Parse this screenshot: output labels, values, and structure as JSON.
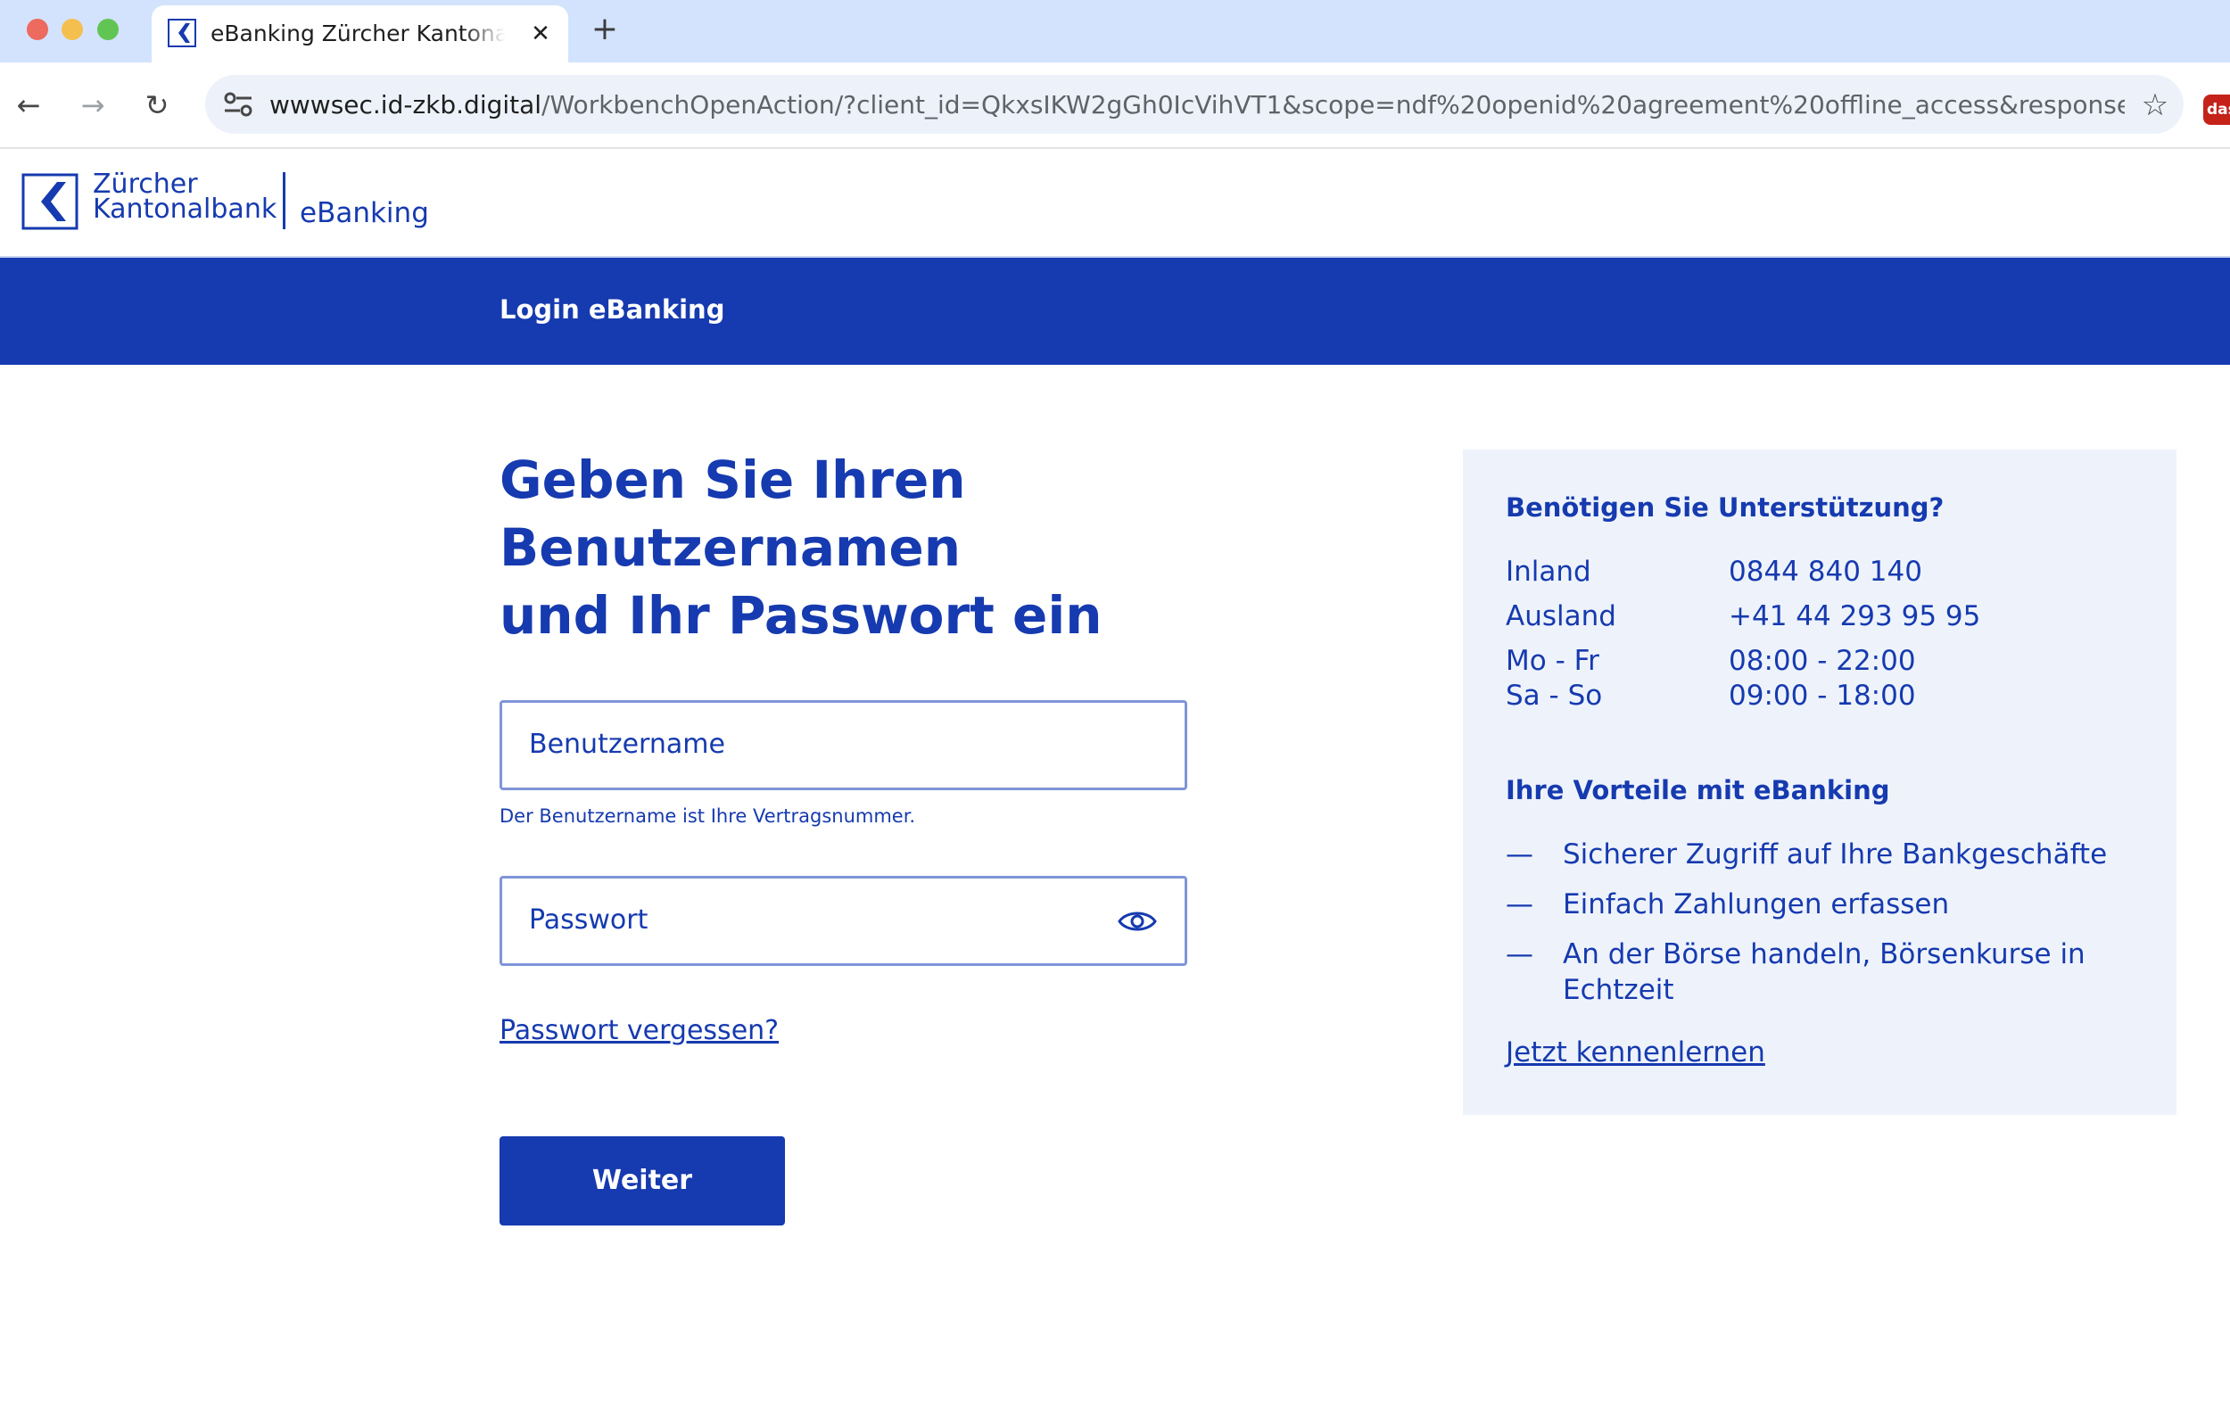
{
  "browser": {
    "tab_title": "eBanking Zürcher Kantonalbank",
    "tab_close": "✕",
    "new_tab": "+",
    "url_host": "wwwsec.id-zkb.digital",
    "url_path": "/WorkbenchOpenAction/?client_id=QkxsIKW2gGh0IcVihVT1&scope=ndf%20openid%20agreement%20offline_access&response_ty...",
    "back_icon": "←",
    "forward_icon": "→",
    "reload_icon": "↻",
    "star_icon": "☆",
    "extension_text": "das"
  },
  "header": {
    "logo_line1": "Zürcher",
    "logo_line2": "Kantonalbank",
    "product": "eBanking"
  },
  "bar": {
    "title": "Login eBanking"
  },
  "login": {
    "heading_line1": "Geben Sie Ihren Benutzernamen",
    "heading_line2": "und Ihr Passwort ein",
    "username_placeholder": "Benutzername",
    "username_hint": "Der Benutzername ist Ihre Vertragsnummer.",
    "password_placeholder": "Passwort",
    "forgot_link": "Passwort vergessen?",
    "submit_label": "Weiter"
  },
  "support": {
    "title": "Benötigen Sie Unterstützung?",
    "rows": [
      {
        "label": "Inland",
        "value": "0844 840 140"
      },
      {
        "label": "Ausland",
        "value": "+41 44 293 95 95"
      },
      {
        "label": "Mo - Fr",
        "value": "08:00 - 22:00"
      },
      {
        "label": "Sa - So",
        "value": "09:00 - 18:00"
      }
    ],
    "benefits_title": "Ihre Vorteile mit eBanking",
    "benefits": [
      {
        "dash": "—",
        "text": "Sicherer Zugriff auf Ihre Bankgeschäfte"
      },
      {
        "dash": "—",
        "text": "Einfach Zahlungen erfassen"
      },
      {
        "dash": "—",
        "text": "An der Börse handeln, Börsenkurse in Echtzeit"
      }
    ],
    "link": "Jetzt kennenlernen"
  },
  "colors": {
    "brand_blue": "#163aaf",
    "panel_bg": "#eef3fb",
    "field_border": "#7f95d8"
  }
}
